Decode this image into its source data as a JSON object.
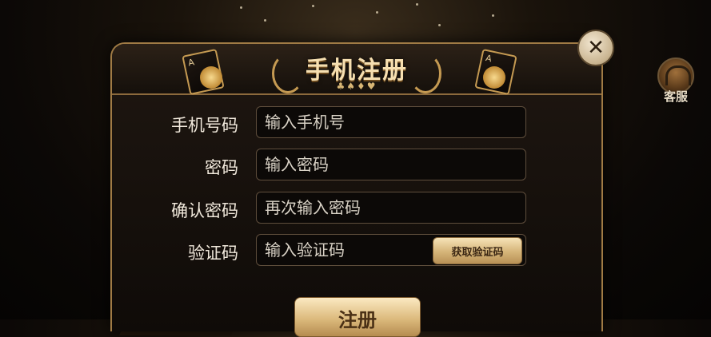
{
  "dialog": {
    "title": "手机注册",
    "suits": "♣♠♦♥",
    "fields": [
      {
        "label": "手机号码",
        "placeholder": "输入手机号"
      },
      {
        "label": "密码",
        "placeholder": "输入密码"
      },
      {
        "label": "确认密码",
        "placeholder": "再次输入密码"
      },
      {
        "label": "验证码",
        "placeholder": "输入验证码"
      }
    ],
    "get_code_label": "获取验证码",
    "submit_label": "注册",
    "close_glyph": "✕"
  },
  "service": {
    "label": "客服"
  },
  "icons": {
    "close": "close-icon",
    "service": "headset-icon"
  },
  "colors": {
    "accent_gold": "#c59a52",
    "title_text": "#f6dfb0",
    "background": "#0b0806"
  }
}
